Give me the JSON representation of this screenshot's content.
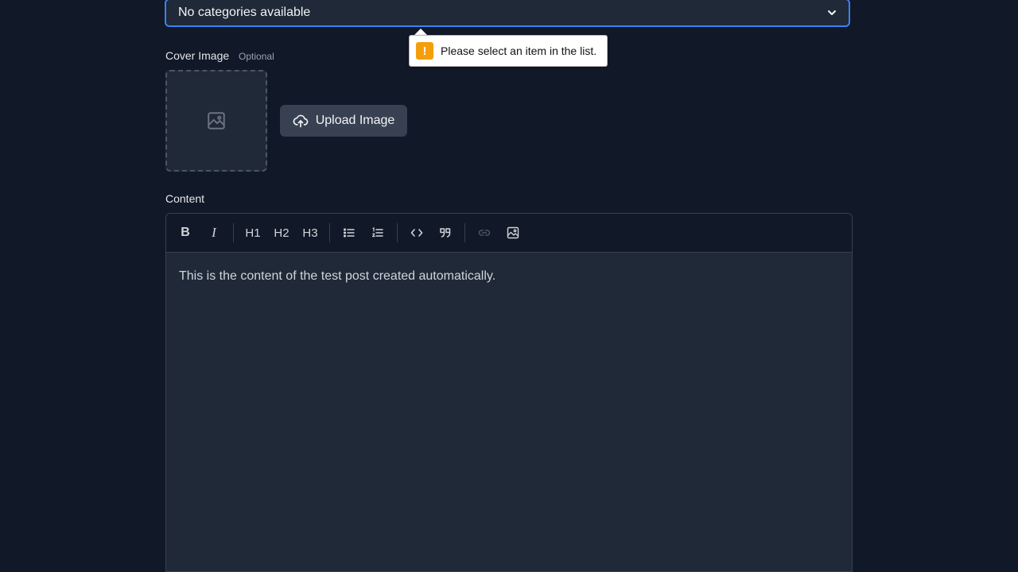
{
  "category_select": {
    "value": "No categories available"
  },
  "validation_tooltip": {
    "icon": "warning-icon",
    "message": "Please select an item in the list."
  },
  "cover_image": {
    "label": "Cover Image",
    "optional": "Optional",
    "placeholder_icon": "image-icon",
    "upload_button": "Upload Image",
    "upload_icon": "cloud-upload-icon"
  },
  "content": {
    "label": "Content",
    "toolbar": {
      "bold": "B",
      "italic": "I",
      "h1": "H1",
      "h2": "H2",
      "h3": "H3",
      "bullet_list_icon": "bullet-list-icon",
      "ordered_list_icon": "ordered-list-icon",
      "code_icon": "code-icon",
      "quote_icon": "quote-icon",
      "link_icon": "link-icon",
      "image_icon": "image-icon"
    },
    "text": "This is the content of the test post created automatically."
  },
  "colors": {
    "background": "#111827",
    "focus_ring": "#3b82f6",
    "warning": "#f59e0b"
  }
}
